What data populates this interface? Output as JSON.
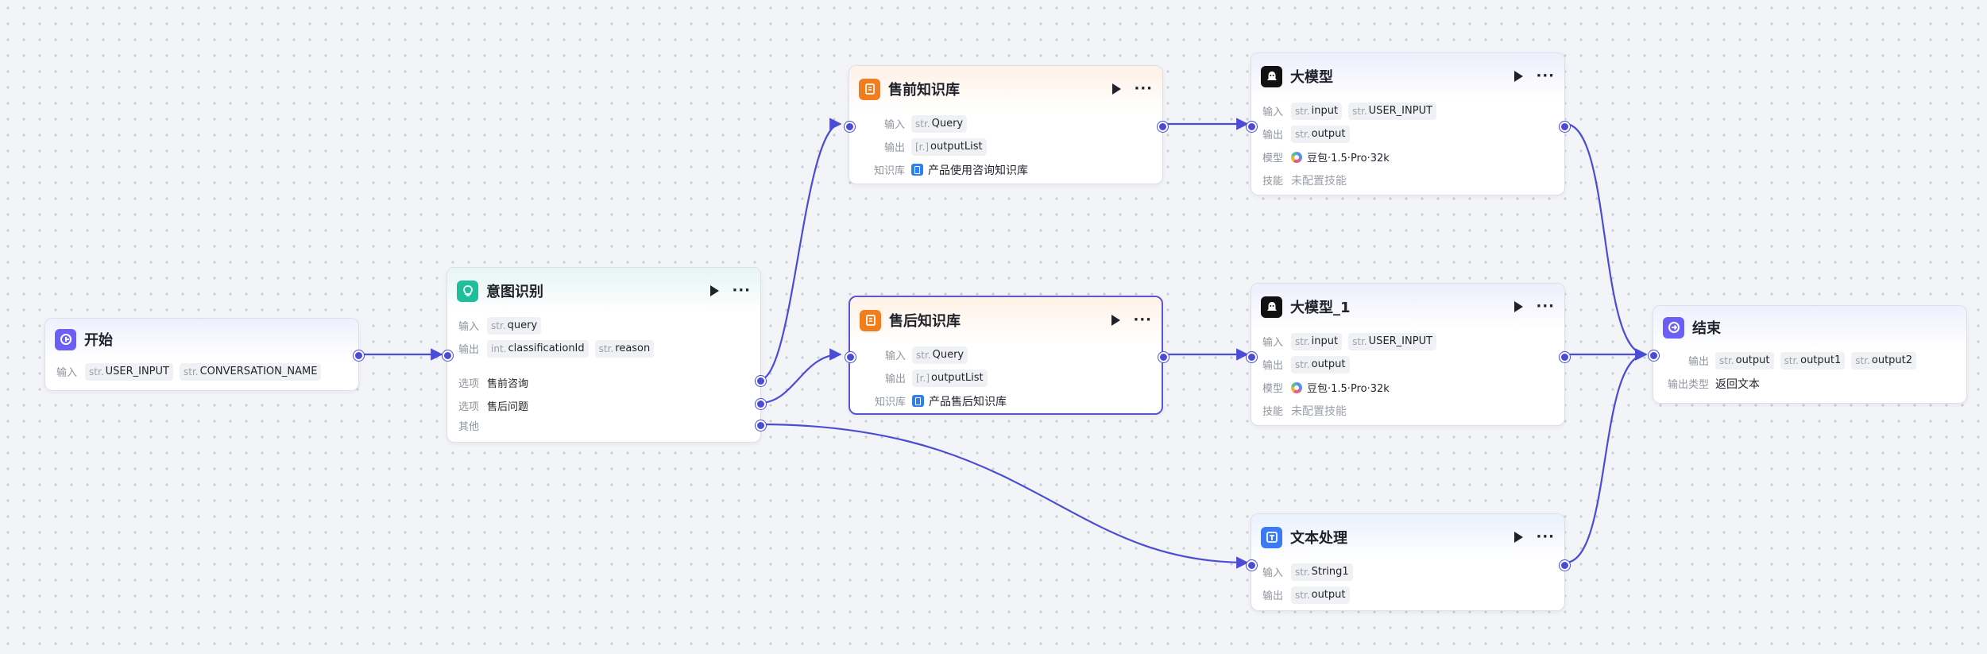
{
  "colors": {
    "edge": "#4b4cd6",
    "start_icon": "#6b5ff6",
    "intent_icon": "#1fbf9b",
    "kb_icon": "#f27d1c",
    "llm_icon": "#111111",
    "text_icon": "#3a7bf5",
    "end_icon": "#6b5ff6"
  },
  "nodes": {
    "start": {
      "icon": "play-circle-icon",
      "title": "开始",
      "input_label": "输入",
      "inputs": [
        {
          "type": "str.",
          "name": "USER_INPUT"
        },
        {
          "type": "str.",
          "name": "CONVERSATION_NAME"
        }
      ]
    },
    "intent": {
      "icon": "lightbulb-icon",
      "title": "意图识别",
      "input_label": "输入",
      "inputs": [
        {
          "type": "str.",
          "name": "query"
        }
      ],
      "output_label": "输出",
      "outputs": [
        {
          "type": "int.",
          "name": "classificationId"
        },
        {
          "type": "str.",
          "name": "reason"
        }
      ],
      "option_label": "选项",
      "options": [
        "售前咨询",
        "售后问题"
      ],
      "other_label": "其他"
    },
    "presale_kb": {
      "icon": "knowledge-base-icon",
      "title": "售前知识库",
      "input_label": "输入",
      "input": {
        "type": "str.",
        "name": "Query"
      },
      "output_label": "输出",
      "output": {
        "type": "[r.]",
        "name": "outputList"
      },
      "kb_label": "知识库",
      "kb_name": "产品使用咨询知识库"
    },
    "aftersale_kb": {
      "icon": "knowledge-base-icon",
      "title": "售后知识库",
      "input_label": "输入",
      "input": {
        "type": "str.",
        "name": "Query"
      },
      "output_label": "输出",
      "output": {
        "type": "[r.]",
        "name": "outputList"
      },
      "kb_label": "知识库",
      "kb_name": "产品售后知识库"
    },
    "llm": {
      "icon": "llm-icon",
      "title": "大模型",
      "input_label": "输入",
      "inputs": [
        {
          "type": "str.",
          "name": "input"
        },
        {
          "type": "str.",
          "name": "USER_INPUT"
        }
      ],
      "output_label": "输出",
      "output": {
        "type": "str.",
        "name": "output"
      },
      "model_label": "模型",
      "model": "豆包·1.5·Pro·32k",
      "skill_label": "技能",
      "skill": "未配置技能"
    },
    "llm1": {
      "icon": "llm-icon",
      "title": "大模型_1",
      "input_label": "输入",
      "inputs": [
        {
          "type": "str.",
          "name": "input"
        },
        {
          "type": "str.",
          "name": "USER_INPUT"
        }
      ],
      "output_label": "输出",
      "output": {
        "type": "str.",
        "name": "output"
      },
      "model_label": "模型",
      "model": "豆包·1.5·Pro·32k",
      "skill_label": "技能",
      "skill": "未配置技能"
    },
    "text": {
      "icon": "text-processing-icon",
      "title": "文本处理",
      "input_label": "输入",
      "input": {
        "type": "str.",
        "name": "String1"
      },
      "output_label": "输出",
      "output": {
        "type": "str.",
        "name": "output"
      }
    },
    "end": {
      "icon": "end-icon",
      "title": "结束",
      "output_label": "输出",
      "outputs": [
        {
          "type": "str.",
          "name": "output"
        },
        {
          "type": "str.",
          "name": "output1"
        },
        {
          "type": "str.",
          "name": "output2"
        }
      ],
      "output_type_label": "输出类型",
      "output_type": "返回文本"
    }
  }
}
